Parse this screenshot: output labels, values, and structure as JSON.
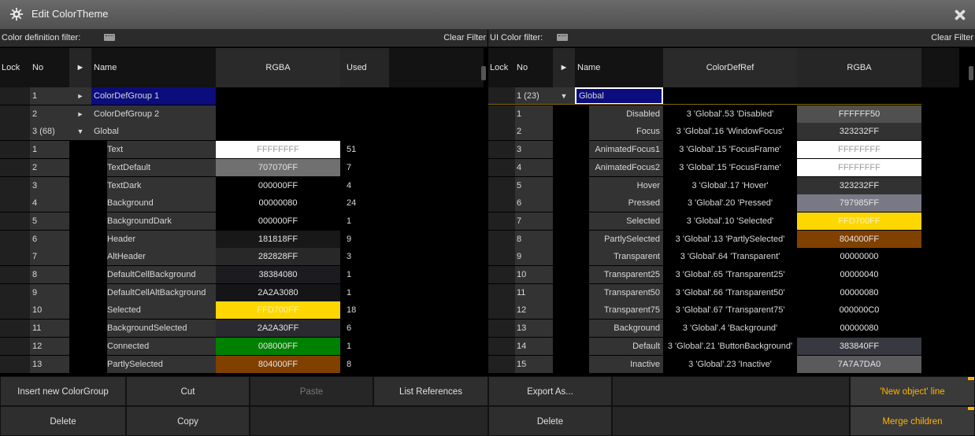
{
  "window": {
    "title": "Edit ColorTheme",
    "gear_icon": "gear-icon",
    "close_icon": "close-icon"
  },
  "left": {
    "filter_label": "Color definition filter:",
    "clear_filter": "Clear Filter",
    "headers": {
      "lock": "Lock",
      "no": "No",
      "arrow": "►",
      "name": "Name",
      "rgba": "RGBA",
      "used": "Used"
    },
    "groups": [
      {
        "no": "1",
        "arrow": "►",
        "name": "ColorDefGroup 1",
        "selected": true
      },
      {
        "no": "2",
        "arrow": "►",
        "name": "ColorDefGroup 2"
      },
      {
        "no": "3 (68)",
        "arrow": "▼",
        "name": "Global"
      }
    ],
    "items": [
      {
        "no": "1",
        "name": "Text",
        "rgba": "FFFFFFFF",
        "used": "51",
        "swatch": "#ffffff",
        "text": "#9a9a9a"
      },
      {
        "no": "2",
        "name": "TextDefault",
        "rgba": "707070FF",
        "used": "7",
        "swatch": "#707070",
        "text": "#e6e6e6"
      },
      {
        "no": "3",
        "name": "TextDark",
        "rgba": "000000FF",
        "used": "4",
        "swatch": "#000000",
        "text": "#e6e6e6"
      },
      {
        "no": "4",
        "name": "Background",
        "rgba": "00000080",
        "used": "24",
        "swatch": "#000000",
        "text": "#e6e6e6"
      },
      {
        "no": "5",
        "name": "BackgroundDark",
        "rgba": "000000FF",
        "used": "1",
        "swatch": "#000000",
        "text": "#e6e6e6"
      },
      {
        "no": "6",
        "name": "Header",
        "rgba": "181818FF",
        "used": "9",
        "swatch": "#181818",
        "text": "#e6e6e6"
      },
      {
        "no": "7",
        "name": "AltHeader",
        "rgba": "282828FF",
        "used": "3",
        "swatch": "#282828",
        "text": "#e6e6e6"
      },
      {
        "no": "8",
        "name": "DefaultCellBackground",
        "rgba": "38384080",
        "used": "1",
        "swatch": "#1c1c20",
        "text": "#e6e6e6"
      },
      {
        "no": "9",
        "name": "DefaultCellAltBackground",
        "rgba": "2A2A3080",
        "used": "1",
        "swatch": "#151518",
        "text": "#e6e6e6"
      },
      {
        "no": "10",
        "name": "Selected",
        "rgba": "FFD700FF",
        "used": "18",
        "swatch": "#ffd700",
        "text": "#f8f0c0"
      },
      {
        "no": "11",
        "name": "BackgroundSelected",
        "rgba": "2A2A30FF",
        "used": "6",
        "swatch": "#2a2a30",
        "text": "#e6e6e6"
      },
      {
        "no": "12",
        "name": "Connected",
        "rgba": "008000FF",
        "used": "1",
        "swatch": "#008000",
        "text": "#e6e6e6"
      },
      {
        "no": "13",
        "name": "PartlySelected",
        "rgba": "804000FF",
        "used": "8",
        "swatch": "#804000",
        "text": "#e6e6e6"
      }
    ]
  },
  "right": {
    "filter_label": "UI Color filter:",
    "clear_filter": "Clear Filter",
    "headers": {
      "lock": "Lock",
      "no": "No",
      "arrow": "►",
      "name": "Name",
      "colordefref": "ColorDefRef",
      "rgba": "RGBA"
    },
    "group": {
      "no": "1 (23)",
      "arrow": "▼",
      "name": "Global"
    },
    "items": [
      {
        "no": "1",
        "name": "Disabled",
        "ref": "3 'Global'.53 'Disabled'",
        "rgba": "FFFFFF50",
        "swatch": "#505050",
        "text": "#e6e6e6"
      },
      {
        "no": "2",
        "name": "Focus",
        "ref": "3 'Global'.16 'WindowFocus'",
        "rgba": "323232FF",
        "swatch": "#323232",
        "text": "#e6e6e6"
      },
      {
        "no": "3",
        "name": "AnimatedFocus1",
        "ref": "3 'Global'.15 'FocusFrame'",
        "rgba": "FFFFFFFF",
        "swatch": "#ffffff",
        "text": "#9a9a9a"
      },
      {
        "no": "4",
        "name": "AnimatedFocus2",
        "ref": "3 'Global'.15 'FocusFrame'",
        "rgba": "FFFFFFFF",
        "swatch": "#ffffff",
        "text": "#9a9a9a"
      },
      {
        "no": "5",
        "name": "Hover",
        "ref": "3 'Global'.17 'Hover'",
        "rgba": "323232FF",
        "swatch": "#323232",
        "text": "#e6e6e6"
      },
      {
        "no": "6",
        "name": "Pressed",
        "ref": "3 'Global'.20 'Pressed'",
        "rgba": "797985FF",
        "swatch": "#797985",
        "text": "#e6e6e6"
      },
      {
        "no": "7",
        "name": "Selected",
        "ref": "3 'Global'.10 'Selected'",
        "rgba": "FFD700FF",
        "swatch": "#ffd700",
        "text": "#f8f0c0"
      },
      {
        "no": "8",
        "name": "PartlySelected",
        "ref": "3 'Global'.13 'PartlySelected'",
        "rgba": "804000FF",
        "swatch": "#804000",
        "text": "#e6e6e6"
      },
      {
        "no": "9",
        "name": "Transparent",
        "ref": "3 'Global'.64 'Transparent'",
        "rgba": "00000000",
        "swatch": "#000000",
        "text": "#e6e6e6"
      },
      {
        "no": "10",
        "name": "Transparent25",
        "ref": "3 'Global'.65 'Transparent25'",
        "rgba": "00000040",
        "swatch": "#000000",
        "text": "#e6e6e6"
      },
      {
        "no": "11",
        "name": "Transparent50",
        "ref": "3 'Global'.66 'Transparent50'",
        "rgba": "00000080",
        "swatch": "#000000",
        "text": "#e6e6e6"
      },
      {
        "no": "12",
        "name": "Transparent75",
        "ref": "3 'Global'.67 'Transparent75'",
        "rgba": "000000C0",
        "swatch": "#000000",
        "text": "#e6e6e6"
      },
      {
        "no": "13",
        "name": "Background",
        "ref": "3 'Global'.4 'Background'",
        "rgba": "00000080",
        "swatch": "#000000",
        "text": "#e6e6e6"
      },
      {
        "no": "14",
        "name": "Default",
        "ref": "3 'Global'.21 'ButtonBackground'",
        "rgba": "383840FF",
        "swatch": "#383840",
        "text": "#e6e6e6"
      },
      {
        "no": "15",
        "name": "Inactive",
        "ref": "3 'Global'.23 'Inactive'",
        "rgba": "7A7A7DA0",
        "swatch": "#5a5a5c",
        "text": "#e6e6e6"
      }
    ]
  },
  "buttons": {
    "insert_new_colorgroup": "Insert new ColorGroup",
    "cut": "Cut",
    "paste": "Paste",
    "list_references": "List References",
    "export_as": "Export As...",
    "new_object_line": "'New object' line",
    "delete_left": "Delete",
    "copy": "Copy",
    "delete_right": "Delete",
    "merge_children": "Merge children"
  },
  "colors": {
    "accent": "#ffb400",
    "selected_blue": "#0b0d7c",
    "focus_border": "#ffffff"
  }
}
